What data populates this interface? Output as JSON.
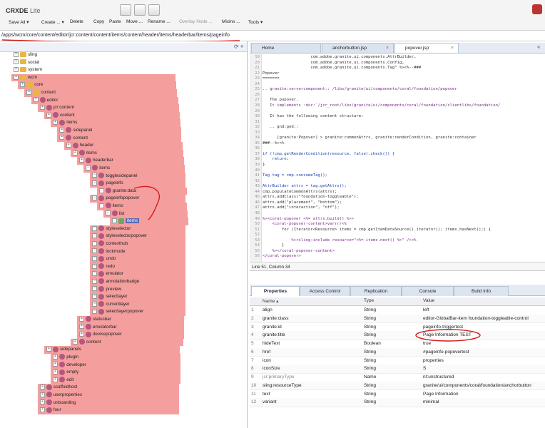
{
  "header": {
    "logo": "CRXDE",
    "logo_suffix": "Lite",
    "toolbar": [
      {
        "label": "Save All ▾",
        "enabled": true
      },
      {
        "label": "Create ... ▾",
        "enabled": true
      },
      {
        "label": "Delete",
        "enabled": true
      },
      {
        "label": "Copy",
        "enabled": true
      },
      {
        "label": "Paste",
        "enabled": true
      },
      {
        "label": "Move ...",
        "enabled": true
      },
      {
        "label": "Rename ...",
        "enabled": true
      },
      {
        "label": "Overlay Node ...",
        "enabled": false
      },
      {
        "label": "Mixins ...",
        "enabled": true
      },
      {
        "label": "Tools ▾",
        "enabled": true
      }
    ]
  },
  "address": "/apps/wcm/core/content/editor/jcr:content/content/items/content/header/items/headerbar/items/pageinfo",
  "tree": [
    {
      "label": "sling",
      "depth": 0,
      "type": "folder",
      "hl": false
    },
    {
      "label": "social",
      "depth": 0,
      "type": "folder",
      "hl": false
    },
    {
      "label": "system",
      "depth": 0,
      "type": "folder",
      "hl": false
    },
    {
      "label": "wcm",
      "depth": 0,
      "type": "folder",
      "hl": true
    },
    {
      "label": "core",
      "depth": 1,
      "type": "folder",
      "hl": true
    },
    {
      "label": "content",
      "depth": 2,
      "type": "folder",
      "hl": true
    },
    {
      "label": "editor",
      "depth": 3,
      "type": "node",
      "hl": true
    },
    {
      "label": "jcr:content",
      "depth": 4,
      "type": "node",
      "hl": true
    },
    {
      "label": "content",
      "depth": 5,
      "type": "node",
      "hl": true
    },
    {
      "label": "items",
      "depth": 6,
      "type": "node",
      "hl": true
    },
    {
      "label": "sidepanel",
      "depth": 7,
      "type": "node",
      "hl": true
    },
    {
      "label": "content",
      "depth": 7,
      "type": "node",
      "hl": true
    },
    {
      "label": "header",
      "depth": 8,
      "type": "node",
      "hl": true
    },
    {
      "label": "items",
      "depth": 9,
      "type": "node",
      "hl": true
    },
    {
      "label": "headerbar",
      "depth": 10,
      "type": "node",
      "hl": true
    },
    {
      "label": "items",
      "depth": 11,
      "type": "node",
      "hl": true
    },
    {
      "label": "togglesidepanel",
      "depth": 12,
      "type": "node",
      "hl": true
    },
    {
      "label": "pageinfo",
      "depth": 12,
      "type": "node",
      "hl": true
    },
    {
      "label": "granite:data",
      "depth": 13,
      "type": "node",
      "hl": true
    },
    {
      "label": "pageinfopopover",
      "depth": 12,
      "type": "node",
      "hl": true
    },
    {
      "label": "items",
      "depth": 13,
      "type": "node",
      "hl": true
    },
    {
      "label": "list",
      "depth": 14,
      "type": "node",
      "hl": true
    },
    {
      "label": "items",
      "depth": 15,
      "type": "leaf",
      "hl": true
    },
    {
      "label": "styleselector",
      "depth": 12,
      "type": "node",
      "hl": true
    },
    {
      "label": "styleselectorpopover",
      "depth": 12,
      "type": "node",
      "hl": true
    },
    {
      "label": "contexthub",
      "depth": 12,
      "type": "node",
      "hl": true
    },
    {
      "label": "lockmode",
      "depth": 12,
      "type": "node",
      "hl": true
    },
    {
      "label": "undo",
      "depth": 12,
      "type": "node",
      "hl": true
    },
    {
      "label": "redo",
      "depth": 12,
      "type": "node",
      "hl": true
    },
    {
      "label": "emulator",
      "depth": 12,
      "type": "node",
      "hl": true
    },
    {
      "label": "annotationbadge",
      "depth": 12,
      "type": "node",
      "hl": true
    },
    {
      "label": "preview",
      "depth": 12,
      "type": "node",
      "hl": true
    },
    {
      "label": "selectlayer",
      "depth": 12,
      "type": "node",
      "hl": true
    },
    {
      "label": "currentlayer",
      "depth": 12,
      "type": "node",
      "hl": true
    },
    {
      "label": "selectlayerpopover",
      "depth": 12,
      "type": "node",
      "hl": true
    },
    {
      "label": "statusbar",
      "depth": 10,
      "type": "node",
      "hl": true
    },
    {
      "label": "emulatorbar",
      "depth": 10,
      "type": "node",
      "hl": true
    },
    {
      "label": "devicepopover",
      "depth": 10,
      "type": "node",
      "hl": true
    },
    {
      "label": "content",
      "depth": 9,
      "type": "node",
      "hl": true
    },
    {
      "label": "sidepanels",
      "depth": 5,
      "type": "node",
      "hl": true
    },
    {
      "label": "plugin",
      "depth": 6,
      "type": "node",
      "hl": true
    },
    {
      "label": "developer",
      "depth": 6,
      "type": "node",
      "hl": true
    },
    {
      "label": "empty",
      "depth": 6,
      "type": "node",
      "hl": true
    },
    {
      "label": "edit",
      "depth": 6,
      "type": "node",
      "hl": true
    },
    {
      "label": "scaffoldhost",
      "depth": 4,
      "type": "node",
      "hl": true
    },
    {
      "label": "userproperties",
      "depth": 4,
      "type": "node",
      "hl": true
    },
    {
      "label": "onboarding",
      "depth": 4,
      "type": "node",
      "hl": true
    },
    {
      "label": "four",
      "depth": 4,
      "type": "node",
      "hl": true
    }
  ],
  "editor": {
    "tabs": [
      "Home",
      "anchorbutton.jsp",
      "popover.jsp"
    ],
    "active_tab": "popover.jsp",
    "lines": [
      {
        "n": "19",
        "t": "                    com.adobe.granite.ui.components.AttrBuilder,"
      },
      {
        "n": "20",
        "t": "                    com.adobe.granite.ui.components.Config,"
      },
      {
        "n": "21",
        "t": "                    com.adobe.granite.ui.components.Tag\" %><%--###"
      },
      {
        "n": "22",
        "t": "Popover"
      },
      {
        "n": "23",
        "t": "======="
      },
      {
        "n": "24",
        "t": ""
      },
      {
        "n": "25",
        "t": ".. granite:servercomponent:: /libs/granite/ui/components/coral/foundation/popover"
      },
      {
        "n": "26",
        "t": ""
      },
      {
        "n": "27",
        "t": "   The popover."
      },
      {
        "n": "28",
        "t": "   It implements :doc:`/jcr_root/libs/granite/ui/components/coral/foundation/clientlibs/foundation/"
      },
      {
        "n": "29",
        "t": ""
      },
      {
        "n": "30",
        "t": "   It has the following content structure:"
      },
      {
        "n": "31",
        "t": ""
      },
      {
        "n": "32",
        "t": "   .. gnd:gnd::"
      },
      {
        "n": "33",
        "t": ""
      },
      {
        "n": "34",
        "t": "      [granite:Popover] > granite:commonAttrs, granite:renderCondition, granite:container"
      },
      {
        "n": "35",
        "t": "###--%><%"
      },
      {
        "n": "36",
        "t": ""
      },
      {
        "n": "37",
        "t": "if (!cmp.getRenderCondition(resource, false).check()) {"
      },
      {
        "n": "38",
        "t": "    return;"
      },
      {
        "n": "39",
        "t": "}"
      },
      {
        "n": "40",
        "t": ""
      },
      {
        "n": "41",
        "t": "Tag tag = cmp.consumeTag();"
      },
      {
        "n": "42",
        "t": ""
      },
      {
        "n": "43",
        "t": "AttrBuilder attrs = tag.getAttrs();"
      },
      {
        "n": "44",
        "t": "cmp.populateCommonAttrs(attrs);"
      },
      {
        "n": "45",
        "t": "attrs.addClass(\"foundation-toggleable\");"
      },
      {
        "n": "46",
        "t": "attrs.add(\"placement\", \"bottom\");"
      },
      {
        "n": "47",
        "t": "attrs.add(\"interaction\", \"off\");"
      },
      {
        "n": "48",
        "t": ""
      },
      {
        "n": "49",
        "t": "%><coral-popover <%= attrs.build() %>>"
      },
      {
        "n": "50",
        "t": "    <coral-popover-content>varrrr<%"
      },
      {
        "n": "51",
        "t": "        for (Iterator<Resource> items = cmp.getItemDataSource().iterator(); items.hasNext();) {"
      },
      {
        "n": "52",
        "t": ""
      },
      {
        "n": "53",
        "t": "            %><sling:include resource=\"<%= items.next() %>\" /><%"
      },
      {
        "n": "54",
        "t": "        }"
      },
      {
        "n": "55",
        "t": "    %></coral-popover-content>"
      },
      {
        "n": "56",
        "t": "</coral-popover>"
      }
    ],
    "status": "Line 51, Column 34"
  },
  "properties": {
    "tabs": [
      "Properties",
      "Access Control",
      "Replication",
      "Console",
      "Build Info"
    ],
    "active_tab": "Properties",
    "columns": [
      "Name ▴",
      "Type",
      "Value"
    ],
    "rows": [
      {
        "idx": "1",
        "name": "align",
        "type": "String",
        "value": "left"
      },
      {
        "idx": "2",
        "name": "granite:class",
        "type": "String",
        "value": "editor-GlobalBar-item foundation-toggleable-control"
      },
      {
        "idx": "3",
        "name": "granite:id",
        "type": "String",
        "value": "pageinfo-triggertest"
      },
      {
        "idx": "4",
        "name": "granite:title",
        "type": "String",
        "value": "Page Information TEST"
      },
      {
        "idx": "5",
        "name": "hideText",
        "type": "Boolean",
        "value": "true"
      },
      {
        "idx": "6",
        "name": "href",
        "type": "String",
        "value": "#pageinfo-popovertest"
      },
      {
        "idx": "7",
        "name": "icon",
        "type": "String",
        "value": "properties"
      },
      {
        "idx": "8",
        "name": "iconSize",
        "type": "String",
        "value": "S"
      },
      {
        "idx": "9",
        "name": "jcr:primaryType",
        "type": "Name",
        "value": "nt:unstructured"
      },
      {
        "idx": "10",
        "name": "sling:resourceType",
        "type": "String",
        "value": "granite/ui/components/coral/foundation/anchorbutton"
      },
      {
        "idx": "11",
        "name": "text",
        "type": "String",
        "value": "Page Information"
      },
      {
        "idx": "12",
        "name": "variant",
        "type": "String",
        "value": "minimal"
      }
    ]
  },
  "colors": {
    "highlight": "#f07e7e",
    "annotation": "#d61e1e",
    "tab_blue": "#dbe3ee"
  }
}
